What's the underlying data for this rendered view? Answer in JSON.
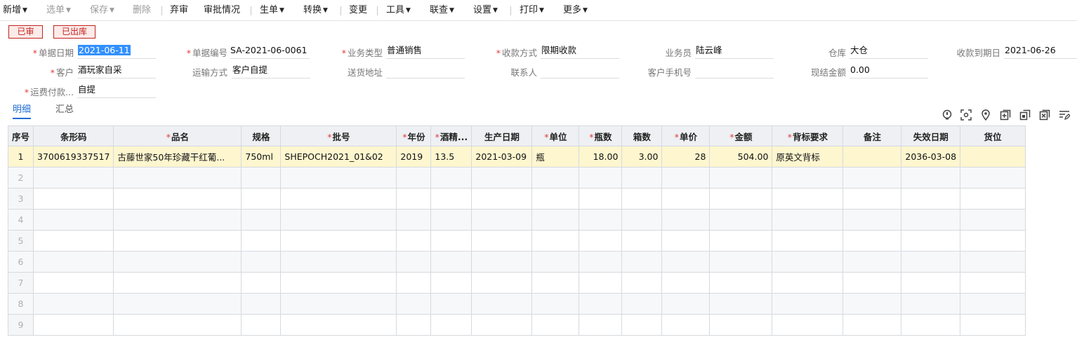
{
  "toolbar": {
    "items": [
      {
        "label": "新增",
        "caret": true,
        "disabled": false
      },
      {
        "label": "选单",
        "caret": true,
        "disabled": true
      },
      {
        "label": "保存",
        "caret": true,
        "disabled": true
      },
      {
        "label": "删除",
        "caret": false,
        "disabled": true
      },
      {
        "label": "弃审",
        "caret": false,
        "disabled": false
      },
      {
        "label": "审批情况",
        "caret": false,
        "disabled": false
      },
      {
        "label": "生单",
        "caret": true,
        "disabled": false
      },
      {
        "label": "转换",
        "caret": true,
        "disabled": false
      },
      {
        "label": "变更",
        "caret": false,
        "disabled": false
      },
      {
        "label": "工具",
        "caret": true,
        "disabled": false
      },
      {
        "label": "联查",
        "caret": true,
        "disabled": false
      },
      {
        "label": "设置",
        "caret": true,
        "disabled": false
      },
      {
        "label": "打印",
        "caret": true,
        "disabled": false
      },
      {
        "label": "更多",
        "caret": true,
        "disabled": false
      }
    ]
  },
  "stamps": {
    "approved": "已审",
    "outbound": "已出库"
  },
  "form": {
    "doc_date": {
      "label": "单据日期",
      "value": "2021-06-11"
    },
    "doc_no": {
      "label": "单据编号",
      "value": "SA-2021-06-0061"
    },
    "biz_type": {
      "label": "业务类型",
      "value": "普通销售"
    },
    "pay_method": {
      "label": "收款方式",
      "value": "限期收款"
    },
    "salesperson": {
      "label": "业务员",
      "value": "陆云峰"
    },
    "warehouse": {
      "label": "仓库",
      "value": "大仓"
    },
    "due_date": {
      "label": "收款到期日",
      "value": "2021-06-26"
    },
    "customer": {
      "label": "客户",
      "value": "酒玩家自采"
    },
    "shipping": {
      "label": "运输方式",
      "value": "客户自提"
    },
    "address": {
      "label": "送货地址",
      "value": ""
    },
    "contact": {
      "label": "联系人",
      "value": ""
    },
    "phone": {
      "label": "客户手机号",
      "value": ""
    },
    "cash_amount": {
      "label": "现结金额",
      "value": "0.00"
    },
    "freight": {
      "label": "运费付款...",
      "value": "自提"
    }
  },
  "tabs": {
    "detail": "明细",
    "summary": "汇总"
  },
  "grid": {
    "headers": [
      {
        "label": "序号",
        "req": false
      },
      {
        "label": "条形码",
        "req": false
      },
      {
        "label": "品名",
        "req": true
      },
      {
        "label": "规格",
        "req": false
      },
      {
        "label": "批号",
        "req": true
      },
      {
        "label": "年份",
        "req": true
      },
      {
        "label": "酒精...",
        "req": true
      },
      {
        "label": "生产日期",
        "req": false
      },
      {
        "label": "单位",
        "req": true
      },
      {
        "label": "瓶数",
        "req": true
      },
      {
        "label": "箱数",
        "req": false
      },
      {
        "label": "单价",
        "req": true
      },
      {
        "label": "金额",
        "req": true
      },
      {
        "label": "背标要求",
        "req": true
      },
      {
        "label": "备注",
        "req": false
      },
      {
        "label": "失效日期",
        "req": false
      },
      {
        "label": "货位",
        "req": false
      }
    ],
    "rows": [
      [
        "1",
        "3700619337517",
        "古藤世家50年珍藏干红葡...",
        "750ml",
        "SHEPOCH2021_01&02",
        "2019",
        "13.5",
        "2021-03-09",
        "瓶",
        "18.00",
        "3.00",
        "28",
        "504.00",
        "原英文背标",
        "",
        "2036-03-08",
        ""
      ]
    ],
    "empty_rows": [
      "2",
      "3",
      "4",
      "5",
      "6",
      "7",
      "8",
      "9"
    ]
  },
  "icons": [
    "bulb-icon",
    "scan-icon",
    "location-icon",
    "add-row-icon",
    "copy-row-icon",
    "delete-row-icon",
    "edit-icon"
  ]
}
